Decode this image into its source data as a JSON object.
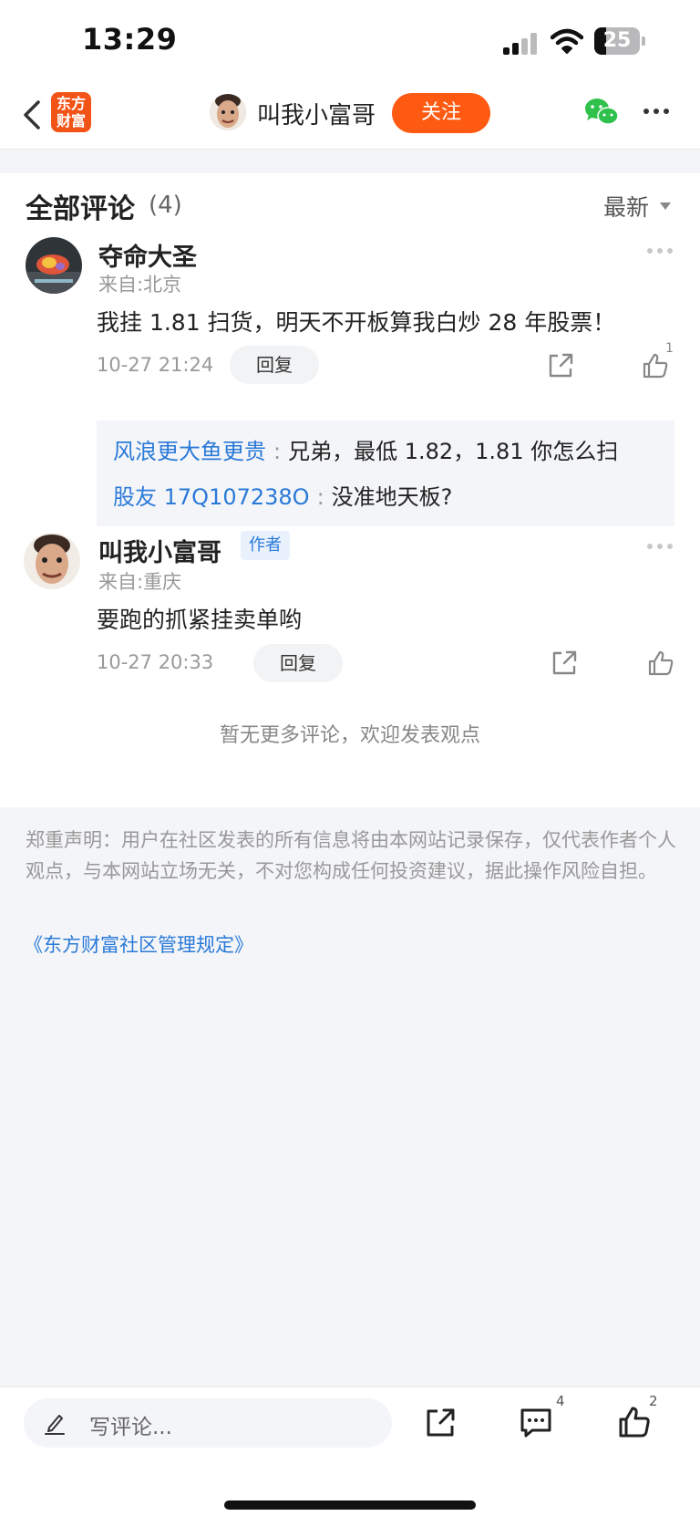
{
  "status_bar": {
    "time": "13:29",
    "battery": "25"
  },
  "nav": {
    "logo_line1": "东方",
    "logo_line2": "财富",
    "username": "叫我小富哥",
    "follow_label": "关注"
  },
  "comments_header": {
    "title": "全部评论",
    "count": "(4)",
    "sort": "最新"
  },
  "comments": [
    {
      "user": "夺命大圣",
      "location": "来自:北京",
      "text": "我挂 1.81 扫货，明天不开板算我白炒 28 年股票！",
      "time": "10-27 21:24",
      "reply_label": "回复",
      "likes": "1",
      "replies": [
        {
          "user": "风浪更大鱼更贵",
          "sep": ":",
          "text": "兄弟，最低 1.82，1.81 你怎么扫"
        },
        {
          "user": "股友 17Q107238O",
          "sep": ":",
          "text": "没准地天板?"
        }
      ]
    },
    {
      "user": "叫我小富哥",
      "author_tag": "作者",
      "location": "来自:重庆",
      "text": "要跑的抓紧挂卖单哟",
      "time": "10-27 20:33",
      "reply_label": "回复"
    }
  ],
  "no_more": "暂无更多评论，欢迎发表观点",
  "disclaimer": "郑重声明：用户在社区发表的所有信息将由本网站记录保存，仅代表作者个人观点，与本网站立场无关，不对您构成任何投资建议，据此操作风险自担。",
  "rules_link": "《东方财富社区管理规定》",
  "bottom_bar": {
    "comment_placeholder": "写评论...",
    "comment_count": "4",
    "like_count": "2"
  },
  "colors": {
    "brand": "#ff5a12",
    "link": "#2a7ad8",
    "wechat": "#2fc14b"
  },
  "icons": [
    "back-icon",
    "logo-icon",
    "wechat-icon",
    "more-icon",
    "share-icon",
    "like-icon",
    "comment-icon",
    "pencil-icon"
  ]
}
